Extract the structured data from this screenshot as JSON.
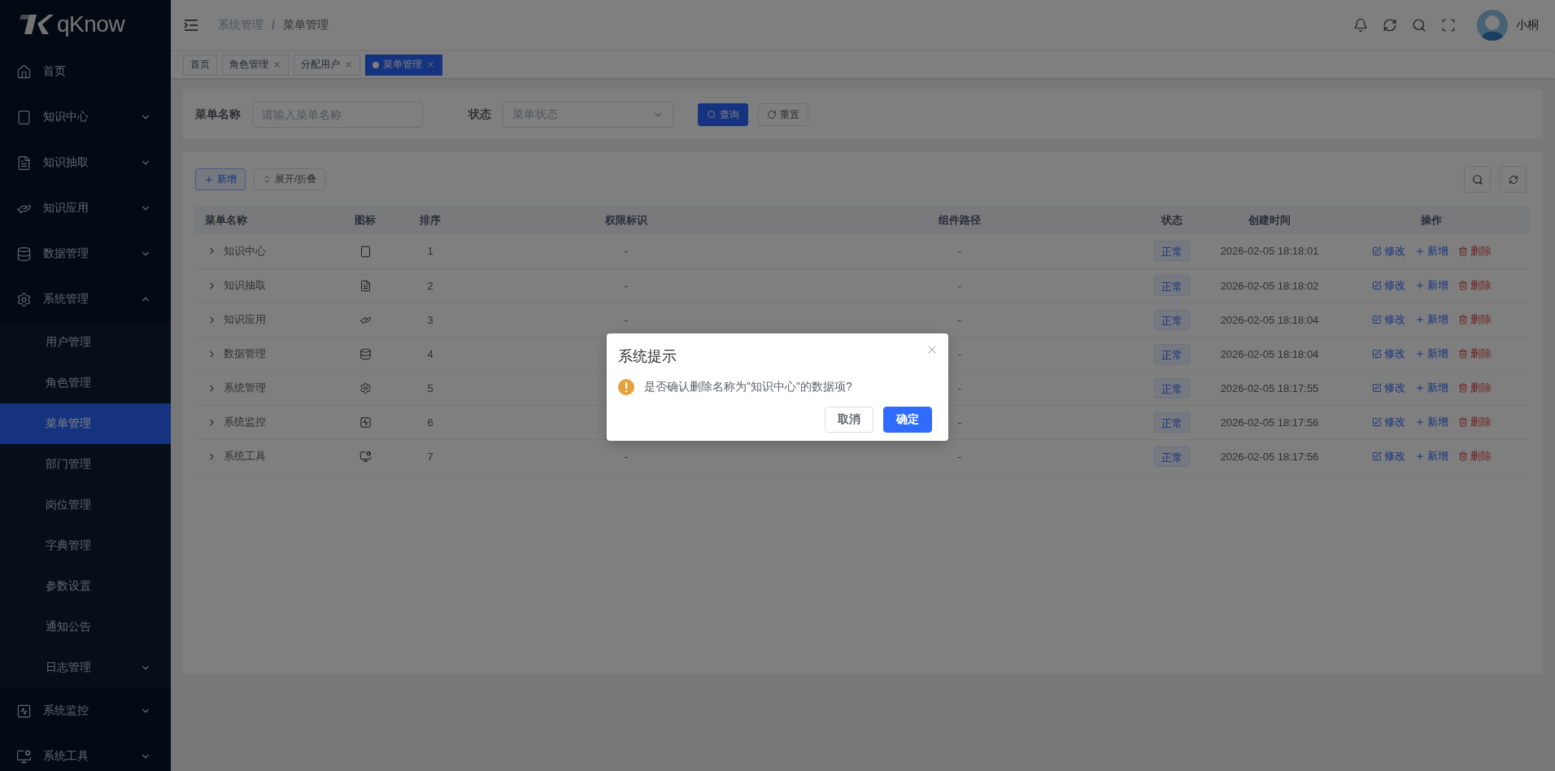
{
  "sidebar": {
    "logo": "qKnow",
    "items": [
      {
        "label": "首页",
        "selected": false
      },
      {
        "label": "知识中心",
        "selected": false,
        "expanded": false
      },
      {
        "label": "知识抽取",
        "selected": false,
        "expanded": false
      },
      {
        "label": "知识应用",
        "selected": false,
        "expanded": false
      },
      {
        "label": "数据管理",
        "selected": false,
        "expanded": false
      },
      {
        "label": "系统管理",
        "selected": false,
        "expanded": true,
        "children": [
          {
            "label": "用户管理",
            "selected": false
          },
          {
            "label": "角色管理",
            "selected": false
          },
          {
            "label": "菜单管理",
            "selected": true
          },
          {
            "label": "部门管理",
            "selected": false
          },
          {
            "label": "岗位管理",
            "selected": false
          },
          {
            "label": "字典管理",
            "selected": false
          },
          {
            "label": "参数设置",
            "selected": false
          },
          {
            "label": "通知公告",
            "selected": false
          },
          {
            "label": "日志管理",
            "selected": false,
            "expanded": false
          }
        ]
      },
      {
        "label": "系统监控",
        "selected": false,
        "expanded": false
      },
      {
        "label": "系统工具",
        "selected": false,
        "expanded": false
      }
    ]
  },
  "header": {
    "breadcrumb": {
      "separator": "/",
      "items": [
        "系统管理",
        "菜单管理"
      ]
    },
    "user": "小桐"
  },
  "tabs": [
    {
      "label": "首页",
      "selected": false,
      "closable": false
    },
    {
      "label": "角色管理",
      "selected": false,
      "closable": true
    },
    {
      "label": "分配用户",
      "selected": false,
      "closable": true
    },
    {
      "label": "菜单管理",
      "selected": true,
      "closable": true
    }
  ],
  "search_form": {
    "fields": [
      {
        "kind": "input",
        "label": "菜单名称",
        "placeholder": "请输入菜单名称"
      },
      {
        "kind": "select",
        "label": "状态",
        "placeholder": "菜单状态"
      }
    ],
    "buttons": [
      {
        "kind": "primary",
        "label": "查询"
      },
      {
        "kind": "default",
        "label": "重置"
      }
    ]
  },
  "toolbar": [
    {
      "kind": "add",
      "label": "新增"
    },
    {
      "kind": "toggle",
      "label": "展开/折叠"
    }
  ],
  "table": {
    "columns": [
      "菜单名称",
      "图标",
      "排序",
      "权限标识",
      "组件路径",
      "状态",
      "创建时间",
      "操作"
    ],
    "rows": [
      {
        "name": "知识中心",
        "expanded": false,
        "order": "1",
        "perms": "-",
        "component": "-",
        "status": "正常",
        "created": "2026-02-05 18:18:01",
        "actions": [
          {
            "kind": "edit",
            "label": "修改"
          },
          {
            "kind": "add",
            "label": "新增"
          },
          {
            "kind": "delete",
            "label": "删除"
          }
        ]
      },
      {
        "name": "知识抽取",
        "expanded": false,
        "order": "2",
        "perms": "-",
        "component": "-",
        "status": "正常",
        "created": "2026-02-05 18:18:02",
        "actions": [
          {
            "kind": "edit",
            "label": "修改"
          },
          {
            "kind": "add",
            "label": "新增"
          },
          {
            "kind": "delete",
            "label": "删除"
          }
        ]
      },
      {
        "name": "知识应用",
        "expanded": false,
        "order": "3",
        "perms": "-",
        "component": "-",
        "status": "正常",
        "created": "2026-02-05 18:18:04",
        "actions": [
          {
            "kind": "edit",
            "label": "修改"
          },
          {
            "kind": "add",
            "label": "新增"
          },
          {
            "kind": "delete",
            "label": "删除"
          }
        ]
      },
      {
        "name": "数据管理",
        "expanded": false,
        "order": "4",
        "component": "-",
        "status": "正常",
        "created": "2026-02-05 18:18:04",
        "actions": [
          {
            "kind": "edit",
            "label": "修改"
          },
          {
            "kind": "add",
            "label": "新增"
          },
          {
            "kind": "delete",
            "label": "删除"
          }
        ]
      },
      {
        "name": "系统管理",
        "expanded": false,
        "order": "5",
        "component": "-",
        "status": "正常",
        "created": "2026-02-05 18:17:55",
        "actions": [
          {
            "kind": "edit",
            "label": "修改"
          },
          {
            "kind": "add",
            "label": "新增"
          },
          {
            "kind": "delete",
            "label": "删除"
          }
        ]
      },
      {
        "name": "系统监控",
        "expanded": false,
        "order": "6",
        "component": "-",
        "status": "正常",
        "created": "2026-02-05 18:17:56",
        "actions": [
          {
            "kind": "edit",
            "label": "修改"
          },
          {
            "kind": "add",
            "label": "新增"
          },
          {
            "kind": "delete",
            "label": "删除"
          }
        ]
      },
      {
        "name": "系统工具",
        "expanded": false,
        "order": "7",
        "perms": "-",
        "component": "-",
        "status": "正常",
        "created": "2026-02-05 18:17:56",
        "actions": [
          {
            "kind": "edit",
            "label": "修改"
          },
          {
            "kind": "add",
            "label": "新增"
          },
          {
            "kind": "delete",
            "label": "删除"
          }
        ]
      }
    ]
  },
  "dialog": {
    "title": "系统提示",
    "message": "是否确认删除名称为\"知识中心\"的数据项?",
    "buttons": [
      {
        "kind": "default",
        "label": "取消"
      },
      {
        "kind": "primary",
        "label": "确定"
      }
    ]
  }
}
